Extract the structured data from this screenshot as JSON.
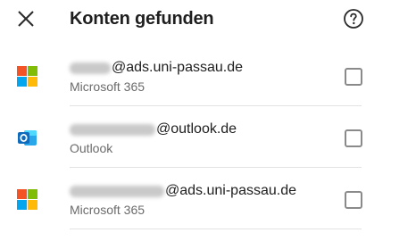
{
  "header": {
    "title": "Konten gefunden",
    "close_icon": "close-icon",
    "help_icon": "help-circle-icon"
  },
  "accounts": [
    {
      "email_suffix": "@ads.uni-passau.de",
      "provider": "Microsoft 365",
      "icon": "microsoft-logo-icon",
      "checked": false
    },
    {
      "email_suffix": "@outlook.de",
      "provider": "Outlook",
      "icon": "outlook-logo-icon",
      "checked": false
    },
    {
      "email_suffix": "@ads.uni-passau.de",
      "provider": "Microsoft 365",
      "icon": "microsoft-logo-icon",
      "checked": false
    }
  ],
  "colors": {
    "ms_red": "#f35325",
    "ms_green": "#81bc06",
    "ms_blue": "#05a6f0",
    "ms_yellow": "#ffba08",
    "outlook_blue": "#0f6cbd",
    "text_primary": "#202020",
    "text_secondary": "#6b6b6b"
  }
}
